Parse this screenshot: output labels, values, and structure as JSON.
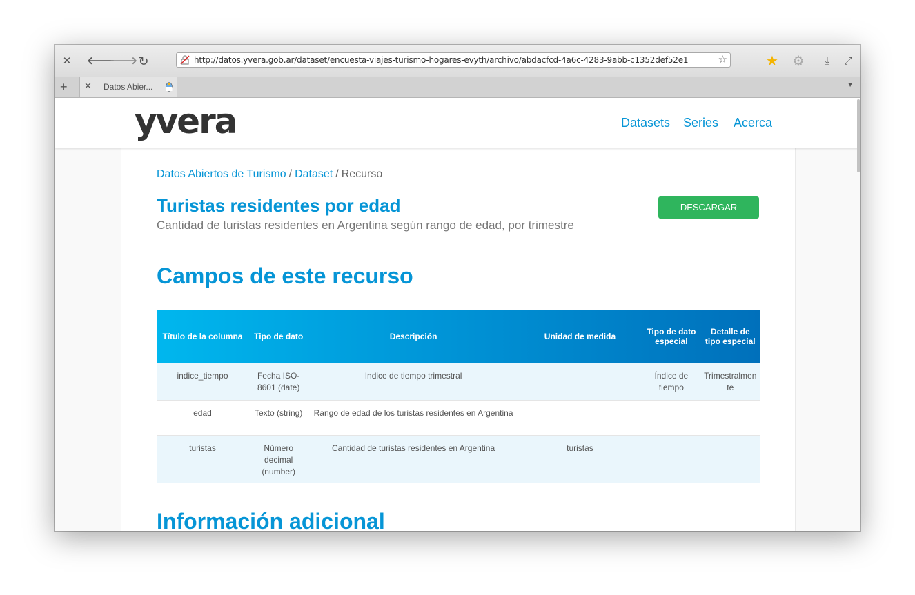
{
  "browser": {
    "url": "http://datos.yvera.gob.ar/dataset/encuesta-viajes-turismo-hogares-evyth/archivo/abdacfcd-4a6c-4283-9abb-c1352def52e1",
    "tab_title": "Datos Abier...",
    "icons": {
      "close": "✕",
      "back": "🡐",
      "forward": "🡒",
      "reload": "↻",
      "bookmark_star": "☆",
      "favorites": "★",
      "settings": "⚙",
      "download": "⤓",
      "fullscreen": "⤢",
      "new_tab": "+",
      "tab_list": "▼"
    }
  },
  "site": {
    "logo": "yvera",
    "nav": [
      "Datasets",
      "Series",
      "Acerca"
    ]
  },
  "page": {
    "breadcrumb": [
      "Datos Abiertos de Turismo",
      "Dataset",
      "Recurso"
    ],
    "breadcrumb_sep": "/",
    "title": "Turistas residentes por edad",
    "subtitle": "Cantidad de turistas residentes en Argentina según rango de edad, por trimestre",
    "download_label": "DESCARGAR",
    "fields_heading": "Campos de este recurso",
    "additional_heading": "Información adicional"
  },
  "table": {
    "headers": [
      "Título de la columna",
      "Tipo de dato",
      "Descripción",
      "Unidad de medida",
      "Tipo de dato especial",
      "Detalle de tipo especial"
    ],
    "rows": [
      [
        "indice_tiempo",
        "Fecha ISO-8601 (date)",
        "Indice de tiempo trimestral",
        "",
        "Índice de tiempo",
        "Trimestralmente"
      ],
      [
        "edad",
        "Texto (string)",
        "Rango de edad de los turistas residentes en Argentina",
        "",
        "",
        ""
      ],
      [
        "turistas",
        "Número decimal (number)",
        "Cantidad de turistas residentes en Argentina",
        "turistas",
        "",
        ""
      ]
    ]
  },
  "colors": {
    "accent": "#0695d6",
    "download_button": "#2fb55d",
    "header_gradient_start": "#00b7ee",
    "header_gradient_end": "#0070bb",
    "alt_row": "#eaf6fc"
  }
}
